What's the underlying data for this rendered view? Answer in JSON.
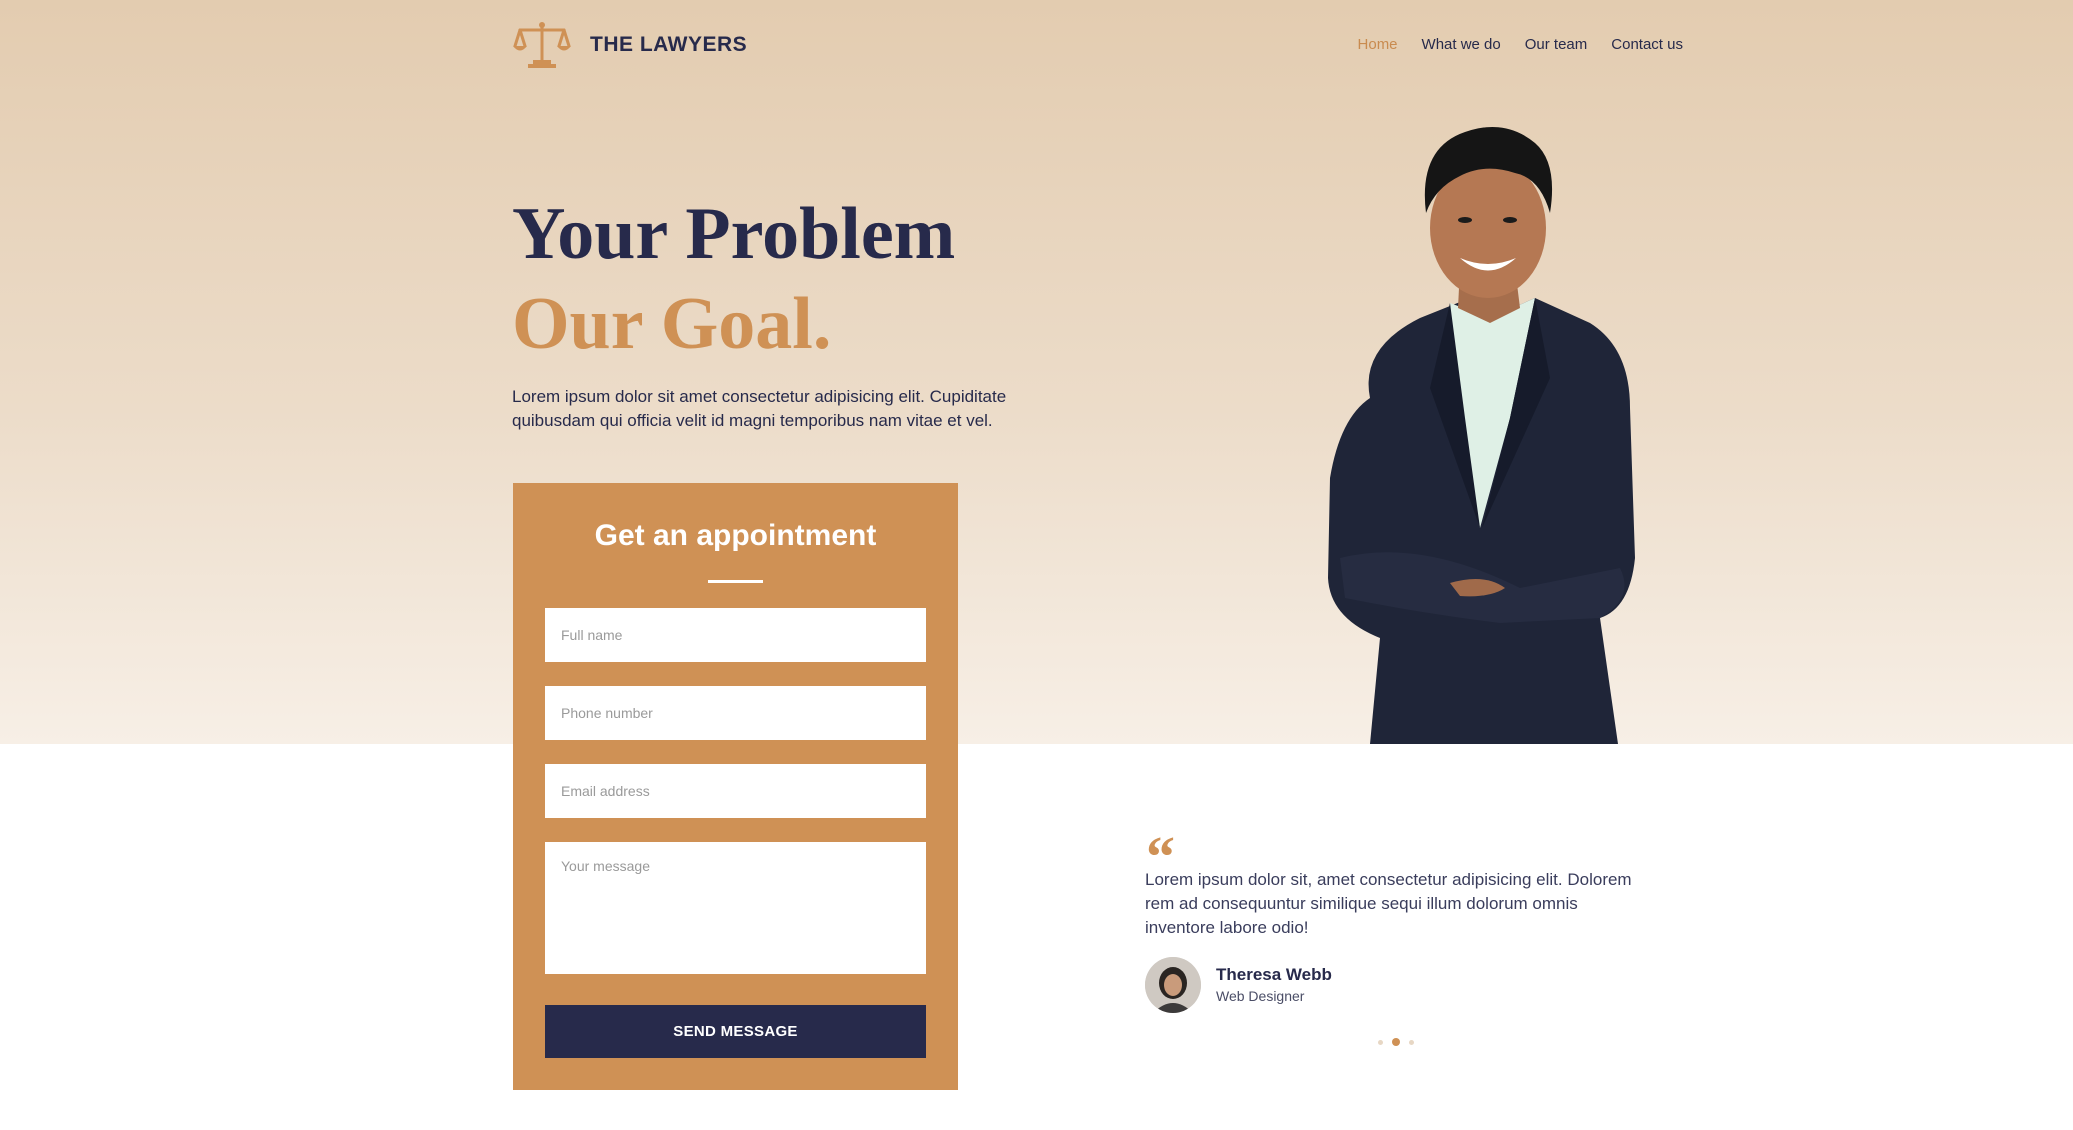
{
  "brand": {
    "name": "THE LAWYERS",
    "logo_icon": "scales-of-justice-icon",
    "accent": "#cf9155",
    "navy": "#272a4b"
  },
  "nav": {
    "items": [
      {
        "label": "Home",
        "active": true
      },
      {
        "label": "What we do",
        "active": false
      },
      {
        "label": "Our team",
        "active": false
      },
      {
        "label": "Contact us",
        "active": false
      }
    ]
  },
  "hero": {
    "headline_line1": "Your Problem",
    "headline_line2": "Our Goal.",
    "intro": "Lorem ipsum dolor sit amet consectetur adipisicing elit. Cupiditate quibusdam qui officia velit id magni temporibus nam vitae et vel."
  },
  "appointment": {
    "title": "Get an appointment",
    "fields": {
      "full_name": {
        "placeholder": "Full name",
        "value": ""
      },
      "phone": {
        "placeholder": "Phone number",
        "value": ""
      },
      "email": {
        "placeholder": "Email address",
        "value": ""
      },
      "message": {
        "placeholder": "Your message",
        "value": ""
      }
    },
    "submit_label": "SEND MESSAGE"
  },
  "testimonial": {
    "quote_mark": "“",
    "text": "Lorem ipsum dolor sit, amet consectetur adipisicing elit. Dolorem rem ad consequuntur similique sequi illum dolorum omnis inventore labore odio!",
    "name": "Theresa Webb",
    "role": "Web Designer",
    "carousel": {
      "slides": 3,
      "active": 2
    }
  }
}
